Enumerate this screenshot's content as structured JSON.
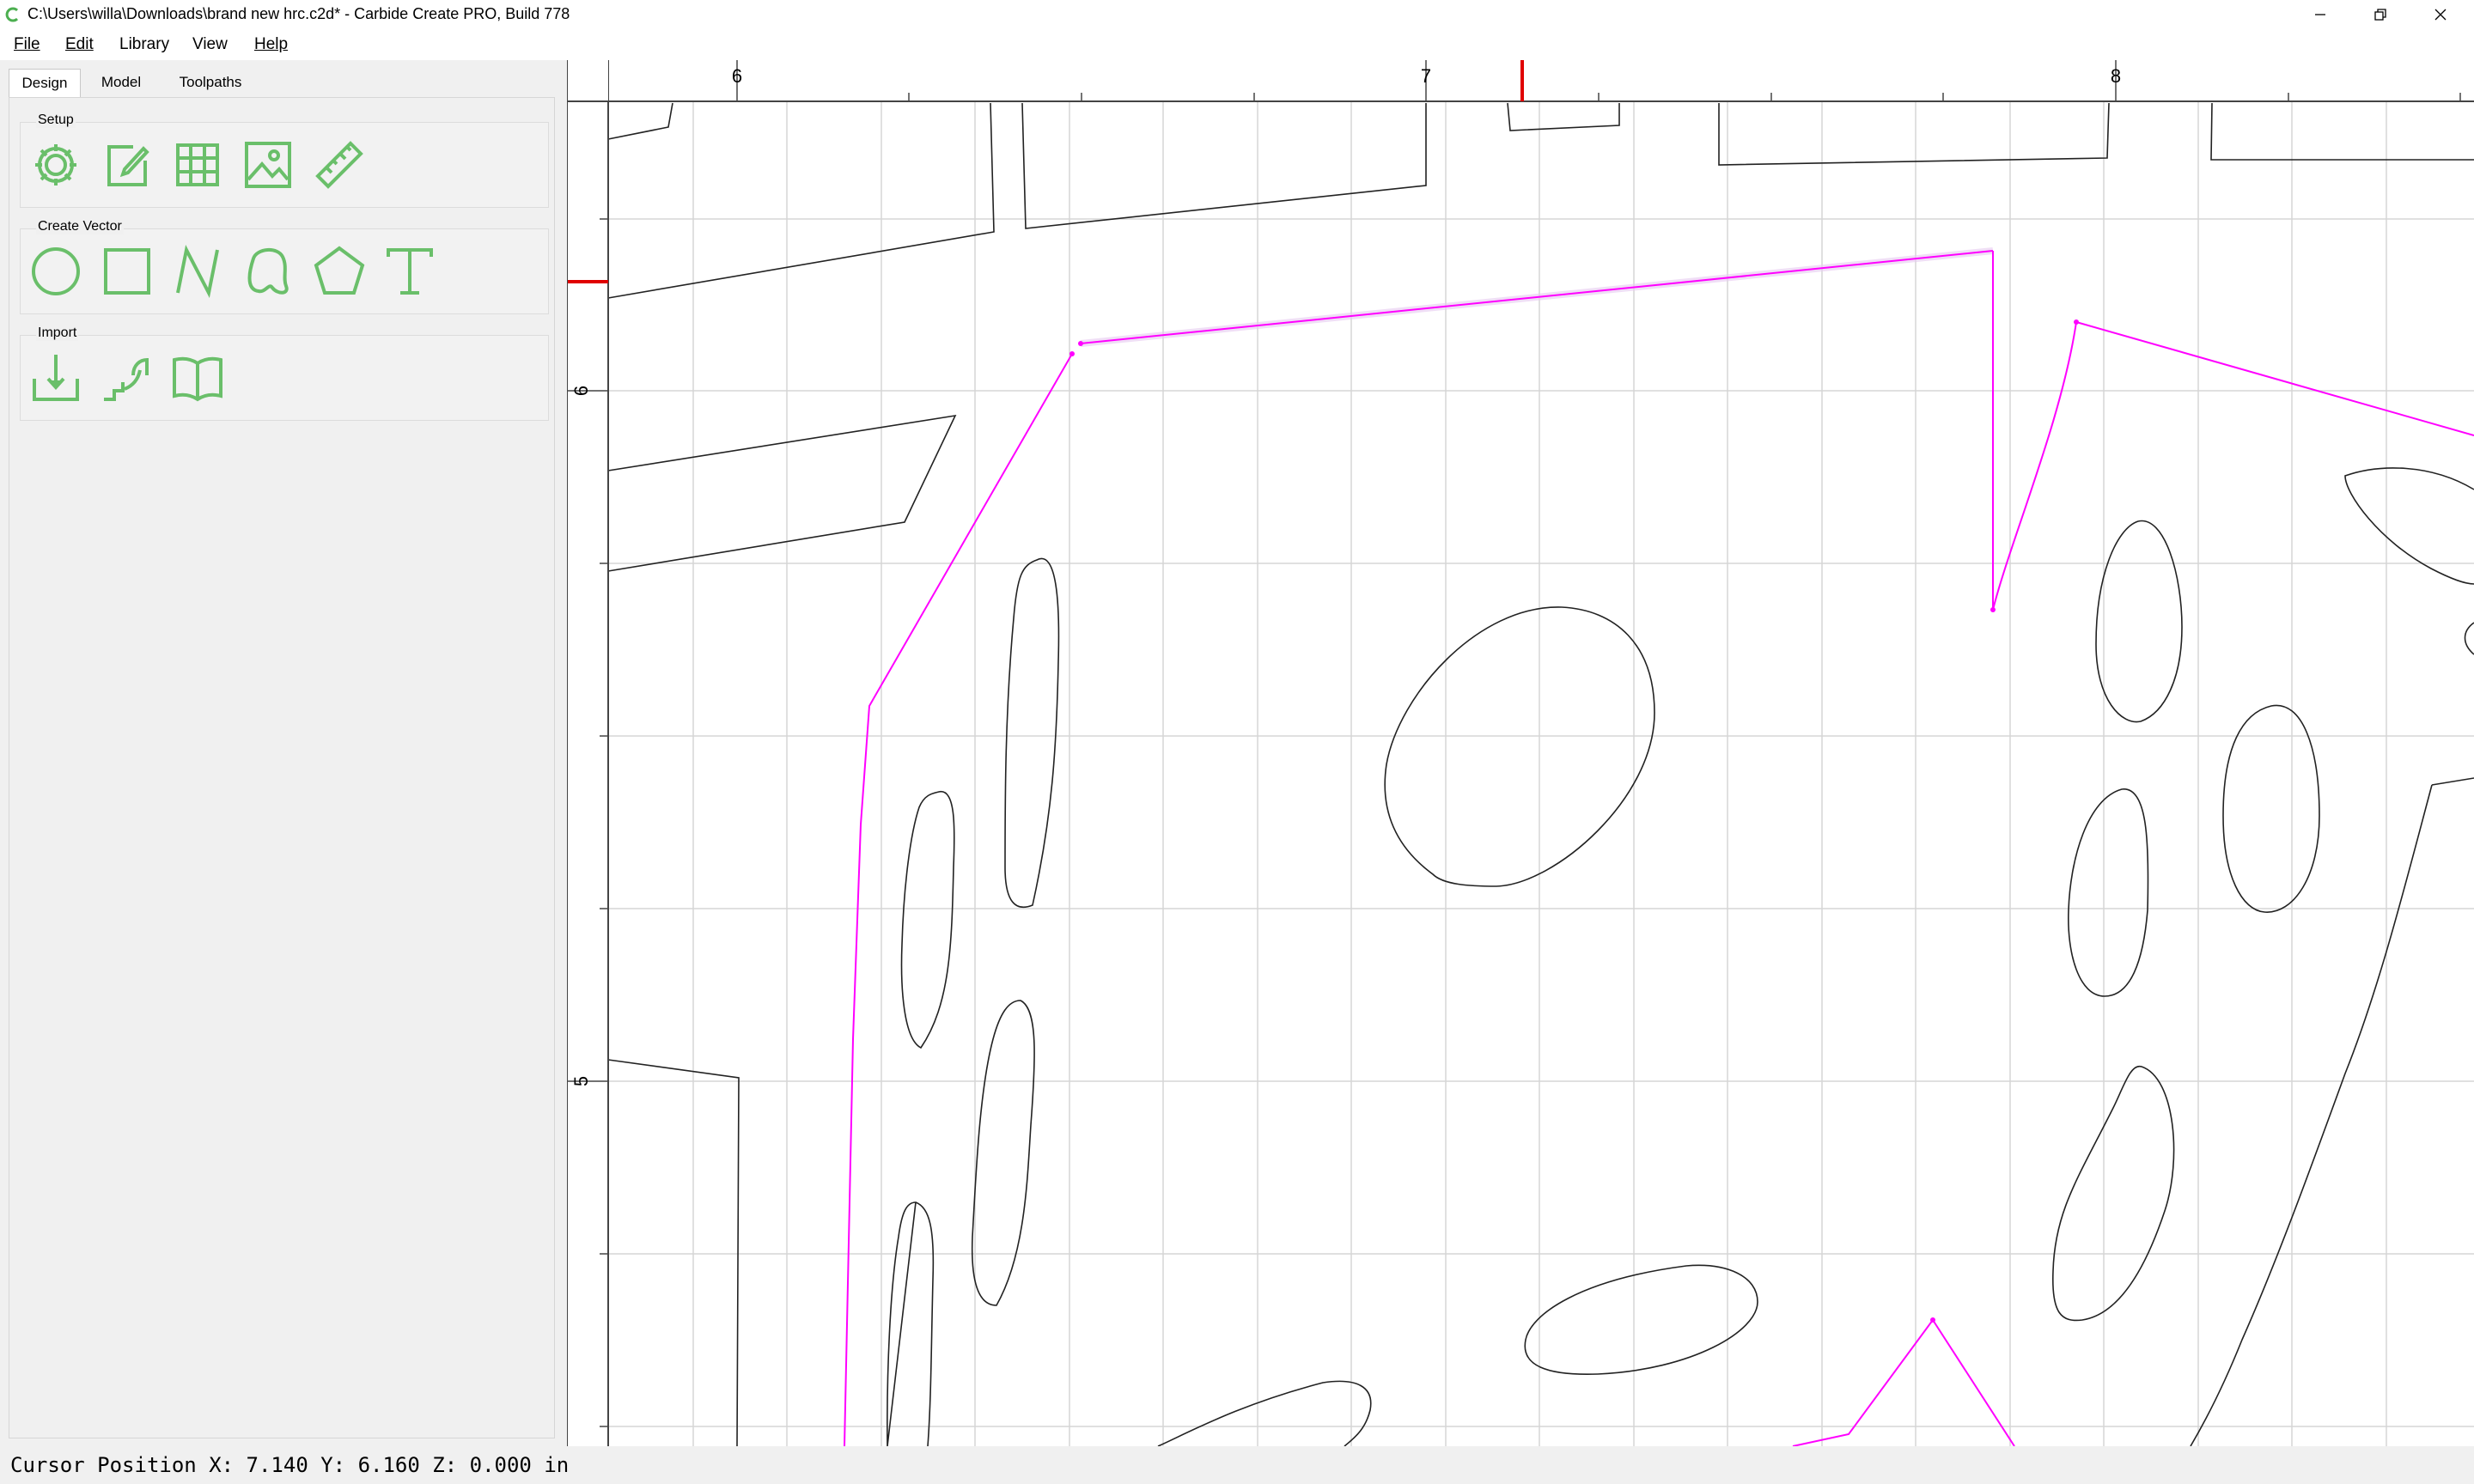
{
  "window": {
    "title": "C:\\Users\\willa\\Downloads\\brand new hrc.c2d* - Carbide Create PRO, Build 778",
    "icon": "carbide-logo-icon",
    "controls": [
      "minimize-icon",
      "restore-icon",
      "close-icon"
    ]
  },
  "menu": {
    "items": [
      {
        "label": "File"
      },
      {
        "label": "Edit"
      },
      {
        "label": "Library"
      },
      {
        "label": "View"
      },
      {
        "label": "Help"
      }
    ]
  },
  "tabs": [
    {
      "label": "Design",
      "active": true
    },
    {
      "label": "Model",
      "active": false
    },
    {
      "label": "Toolpaths",
      "active": false
    }
  ],
  "groups": {
    "setup": {
      "title": "Setup",
      "tools": [
        "gear-icon",
        "edit-document-icon",
        "grid-icon",
        "image-icon",
        "ruler-icon"
      ]
    },
    "create_vector": {
      "title": "Create Vector",
      "tools": [
        "circle-icon",
        "rectangle-icon",
        "polyline-icon",
        "curve-icon",
        "polygon-icon",
        "text-icon"
      ]
    },
    "import": {
      "title": "Import",
      "tools": [
        "import-file-icon",
        "import-stairs-icon",
        "library-book-icon"
      ]
    }
  },
  "accent_color": "#6abf6a",
  "ruler": {
    "x_labels": [
      "6",
      "7",
      "8"
    ],
    "y_labels": [
      "6",
      "5"
    ],
    "cursor_marker_color": "#e00000"
  },
  "selection_color": "#ff00ff",
  "status": {
    "text": "Cursor Position X: 7.140 Y: 6.160 Z: 0.000 in"
  }
}
